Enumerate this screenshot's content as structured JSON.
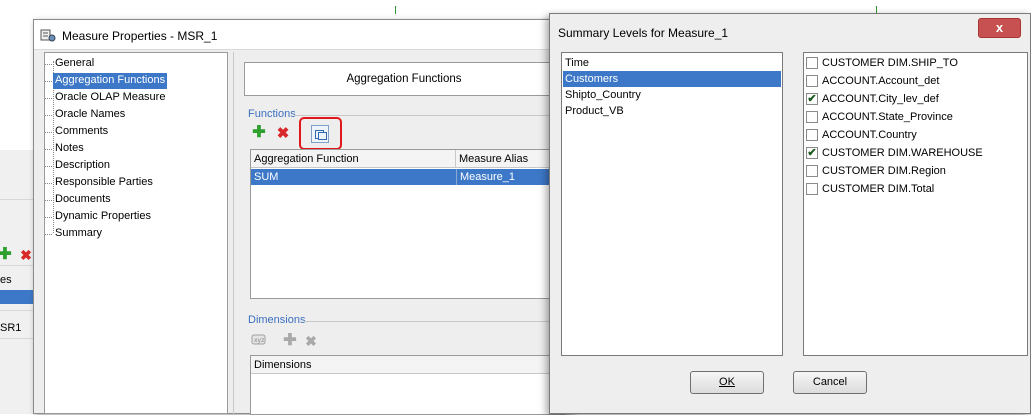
{
  "background": {
    "left_fragments": [
      "es",
      "SR1"
    ]
  },
  "main_dialog": {
    "title": "Measure Properties - MSR_1",
    "tree": [
      {
        "label": "General"
      },
      {
        "label": "Aggregation Functions",
        "selected": true
      },
      {
        "label": "Oracle OLAP Measure"
      },
      {
        "label": "Oracle Names"
      },
      {
        "label": "Comments"
      },
      {
        "label": "Notes"
      },
      {
        "label": "Description"
      },
      {
        "label": "Responsible Parties"
      },
      {
        "label": "Documents"
      },
      {
        "label": "Dynamic Properties"
      },
      {
        "label": "Summary"
      }
    ],
    "header": "Aggregation Functions",
    "functions_group": "Functions",
    "functions_table": {
      "columns": [
        "Aggregation Function",
        "Measure Alias"
      ],
      "rows": [
        [
          "SUM",
          "Measure_1"
        ]
      ]
    },
    "dimensions_group": "Dimensions",
    "dimensions_table": {
      "columns": [
        "Dimensions"
      ]
    }
  },
  "summary_dialog": {
    "title": "Summary Levels for Measure_1",
    "close_label": "x",
    "left_list": [
      {
        "label": "Time"
      },
      {
        "label": "Customers",
        "selected": true
      },
      {
        "label": "Shipto_Country"
      },
      {
        "label": "Product_VB"
      }
    ],
    "right_list": [
      {
        "label": "CUSTOMER DIM.SHIP_TO",
        "checked": false
      },
      {
        "label": "ACCOUNT.Account_det",
        "checked": false
      },
      {
        "label": "ACCOUNT.City_lev_def",
        "checked": true
      },
      {
        "label": "ACCOUNT.State_Province",
        "checked": false
      },
      {
        "label": "ACCOUNT.Country",
        "checked": false
      },
      {
        "label": "CUSTOMER DIM.WAREHOUSE",
        "checked": true
      },
      {
        "label": "CUSTOMER DIM.Region",
        "checked": false
      },
      {
        "label": "CUSTOMER DIM.Total",
        "checked": false
      }
    ],
    "ok_label": "OK",
    "cancel_label": "Cancel"
  },
  "colors": {
    "selection": "#3d78c8",
    "group_label": "#3d6fbf",
    "highlight_ring": "#e0181b",
    "add_icon": "#2ea02e",
    "delete_icon": "#d8282a"
  }
}
